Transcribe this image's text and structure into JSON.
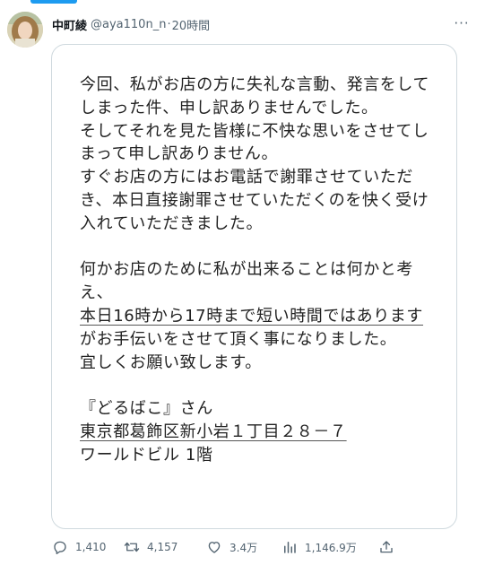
{
  "user": {
    "display_name": "中町綾",
    "handle": "@aya110n_n",
    "separator": "·",
    "time": "20時間",
    "more_label": "···"
  },
  "card": {
    "paragraphs": [
      [
        "今回、私がお店の方に失礼な言動、発言をして",
        "しまった件、申し訳ありませんでした。",
        "そしてそれを見た皆様に不快な思いをさせてし",
        "まって申し訳ありません。",
        "すぐお店の方にはお電話で謝罪させていただ",
        "き、本日直接謝罪させていただくのを快く受け",
        "入れていただきました。"
      ],
      [
        "何かお店のために私が出来ることは何かと考",
        "え、",
        "本日16時から17時まで短い時間ではあります",
        "がお手伝いをさせて頂く事になりました。",
        "宜しくお願い致します。"
      ],
      [
        "『どるばこ』さん",
        "東京都葛飾区新小岩１丁目２８－７",
        "ワールドビル 1階"
      ]
    ]
  },
  "actions": {
    "replies": "1,410",
    "retweets": "4,157",
    "likes": "3.4万",
    "views": "1,146.9万"
  },
  "icons": {
    "reply": "reply-icon",
    "retweet": "retweet-icon",
    "like": "like-icon",
    "views": "views-icon",
    "share": "share-icon"
  },
  "colors": {
    "accent": "#1d9bf0",
    "secondary_text": "#536471",
    "border": "#cfd9de"
  }
}
